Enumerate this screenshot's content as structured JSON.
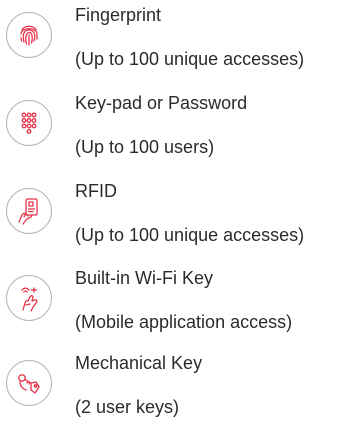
{
  "accent_color": "#e8334a",
  "features": [
    {
      "icon": "fingerprint-icon",
      "title": "Fingerprint",
      "subtitle": "(Up to 100 unique accesses)"
    },
    {
      "icon": "keypad-icon",
      "title": "Key-pad or Password",
      "subtitle": "(Up to 100 users)"
    },
    {
      "icon": "rfid-card-icon",
      "title": "RFID",
      "subtitle": "(Up to 100 unique accesses)"
    },
    {
      "icon": "wifi-hand-icon",
      "title": "Built-in Wi-Fi Key",
      "subtitle": "(Mobile application access)"
    },
    {
      "icon": "mechanical-key-icon",
      "title": "Mechanical Key",
      "subtitle": "(2 user keys)"
    }
  ]
}
